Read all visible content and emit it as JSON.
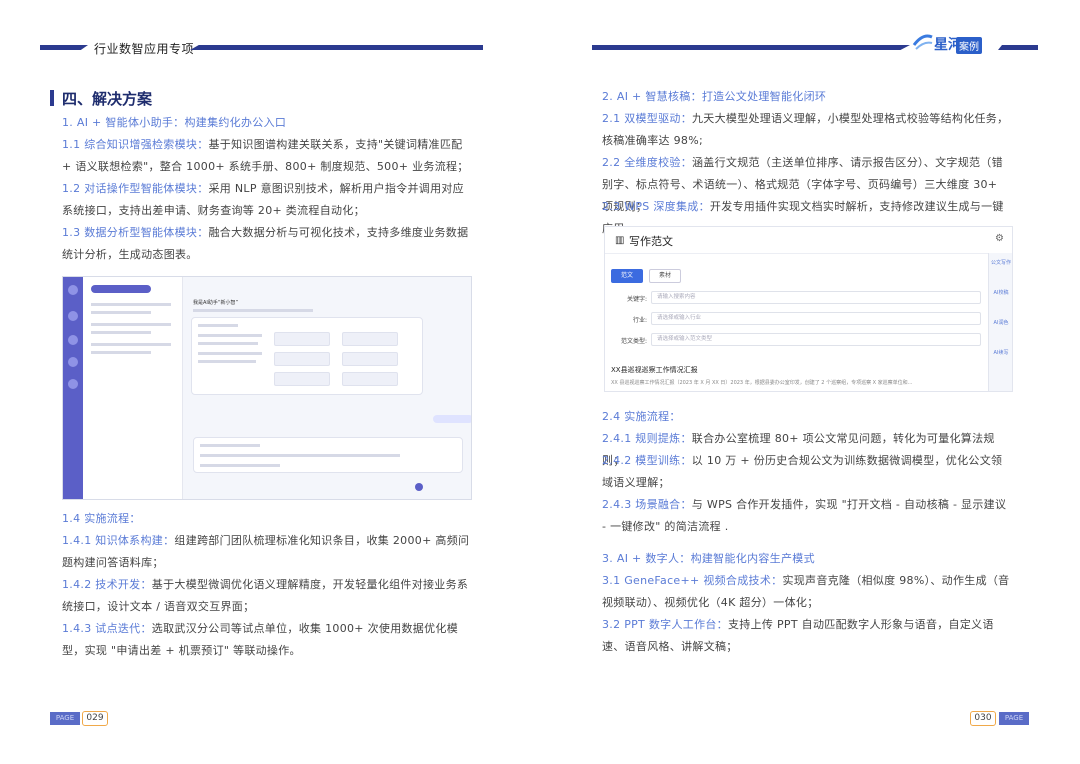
{
  "left": {
    "header_title": "行业数智应用专项",
    "section_title": "四、解决方案",
    "paragraphs": [
      {
        "hl": "1. AI + 智能体小助手：构建集约化办公入口",
        "text": ""
      },
      {
        "hl": "1.1 综合知识增强检索模块：",
        "text": "基于知识图谱构建关联关系，支持\"关键词精准匹配 + 语义联想检索\"，整合 1000+ 系统手册、800+ 制度规范、500+ 业务流程；"
      },
      {
        "hl": "1.2 对话操作型智能体模块：",
        "text": "采用 NLP 意图识别技术，解析用户指令并调用对应系统接口，支持出差申请、财务查询等 20+ 类流程自动化；"
      },
      {
        "hl": "1.3 数据分析型智能体模块：",
        "text": "融合大数据分析与可视化技术，支持多维度业务数据统计分析，生成动态图表。"
      },
      {
        "hl": "1.4 实施流程：",
        "text": ""
      },
      {
        "hl": "1.4.1 知识体系构建：",
        "text": "组建跨部门团队梳理标准化知识条目，收集 2000+ 高频问题构建问答语料库；"
      },
      {
        "hl": "1.4.2 技术开发：",
        "text": "基于大模型微调优化语义理解精度，开发轻量化组件对接业务系统接口，设计文本 / 语音双交互界面；"
      },
      {
        "hl": "1.4.3 试点迭代：",
        "text": "选取武汉分公司等试点单位，收集 1000+ 次使用数据优化模型，实现 \"申请出差 + 机票预订\" 等联动操作。"
      }
    ],
    "page_badge": "PAGE",
    "page_number": "029"
  },
  "right": {
    "logo_text": "星河",
    "logo_tag": "案例",
    "paragraphs": [
      {
        "hl": "2. AI + 智慧核稿：打造公文处理智能化闭环",
        "text": ""
      },
      {
        "hl": "2.1 双模型驱动：",
        "text": "九天大模型处理语义理解，小模型处理格式校验等结构化任务，核稿准确率达 98%;"
      },
      {
        "hl": "2.2 全维度校验：",
        "text": "涵盖行文规范（主送单位排序、请示报告区分）、文字规范（错别字、标点符号、术语统一）、格式规范（字体字号、页码编号）三大维度 30+ 项规则；"
      },
      {
        "hl": "2.3 WPS 深度集成：",
        "text": "开发专用插件实现文档实时解析，支持修改建议生成与一键应用。"
      },
      {
        "hl": "2.4 实施流程：",
        "text": ""
      },
      {
        "hl": "2.4.1 规则提炼：",
        "text": "联合办公室梳理 80+ 项公文常见问题，转化为可量化算法规则；"
      },
      {
        "hl": "2.4.2 模型训练：",
        "text": "以 10 万 + 份历史合规公文为训练数据微调模型，优化公文领域语义理解；"
      },
      {
        "hl": "2.4.3 场景融合：",
        "text": "与 WPS 合作开发插件，实现 \"打开文档 - 自动核稿 - 显示建议 - 一键修改\" 的简洁流程 ."
      },
      {
        "hl": "3. AI + 数字人：构建智能化内容生产模式",
        "text": ""
      },
      {
        "hl": "3.1 GeneFace++ 视频合成技术：",
        "text": "实现声音克隆（相似度 98%）、动作生成（音视频联动）、视频优化（4K 超分）一体化；"
      },
      {
        "hl": "3.2 PPT 数字人工作台：",
        "text": "支持上传 PPT 自动匹配数字人形象与语音，自定义语速、语音风格、讲解文稿；"
      }
    ],
    "writer": {
      "title": "写作范文",
      "tab_active": "范文",
      "tab_inactive": "素材",
      "fields": [
        {
          "label": "关键字:",
          "placeholder": "请输入搜索内容"
        },
        {
          "label": "行业:",
          "placeholder": "请选择或输入行业"
        },
        {
          "label": "范文类型:",
          "placeholder": "请选择或输入范文类型"
        }
      ],
      "side_items": [
        "公文写作",
        "AI校稿",
        "AI润色",
        "AI续写",
        ""
      ],
      "doc_title": "XX县巡视巡察工作情况汇报",
      "doc_body": "XX 县巡视巡察工作情况汇报（2023 年 X 月 XX 日）2023 年，根据县委办公室印发，创建了 2 个巡察组，专项巡察 X 家巡察单位和..."
    },
    "page_number": "030",
    "page_badge": "PAGE"
  },
  "chat_mock": {
    "assistant_title": "我是AI助手“新小智”"
  }
}
